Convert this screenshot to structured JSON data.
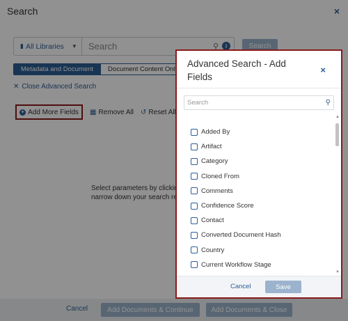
{
  "dialog": {
    "title": "Search",
    "close_glyph": "×",
    "library_label": "All Libraries",
    "search_placeholder": "Search",
    "search_button": "Search",
    "tabs": [
      {
        "label": "Metadata and Document"
      },
      {
        "label": "Document Content Only"
      }
    ],
    "close_advanced": "Close Advanced Search",
    "add_more_fields": "Add More Fields",
    "remove_all": "Remove All",
    "reset_all": "Reset All",
    "hint_line1": "Select parameters by clicking",
    "hint_line2": "narrow down your search re",
    "footer": {
      "cancel": "Cancel",
      "add_continue": "Add Documents & Continue",
      "add_close": "Add Documents & Close"
    }
  },
  "modal": {
    "title": "Advanced Search - Add Fields",
    "close_glyph": "×",
    "search_placeholder": "Search",
    "fields": [
      {
        "label": "Added By",
        "checked": false
      },
      {
        "label": "Artifact",
        "checked": false
      },
      {
        "label": "Category",
        "checked": false
      },
      {
        "label": "Cloned From",
        "checked": false
      },
      {
        "label": "Comments",
        "checked": false
      },
      {
        "label": "Confidence Score",
        "checked": false
      },
      {
        "label": "Contact",
        "checked": false
      },
      {
        "label": "Converted Document Hash",
        "checked": false
      },
      {
        "label": "Country",
        "checked": false
      },
      {
        "label": "Current Workflow Stage",
        "checked": false
      }
    ],
    "cancel": "Cancel",
    "save": "Save"
  },
  "colors": {
    "accent": "#2c5e95",
    "disabled_button": "#9bb3cd",
    "highlight_border": "#8b1a1a"
  }
}
